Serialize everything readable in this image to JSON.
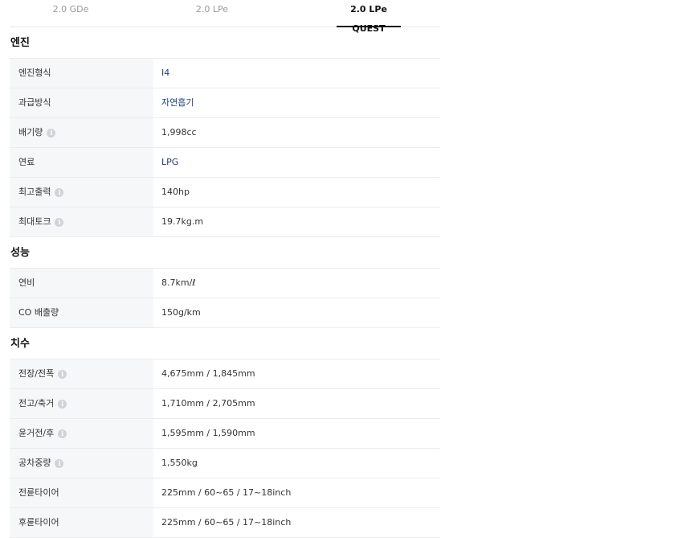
{
  "tabs": [
    {
      "label": "2.0 GDe"
    },
    {
      "label": "2.0 LPe"
    },
    {
      "label": "2.0 LPe QUEST"
    }
  ],
  "sections": {
    "engine": {
      "title": "엔진",
      "rows": [
        {
          "label": "엔진형식",
          "value": "I4"
        },
        {
          "label": "과급방식",
          "value": "자연흡기"
        },
        {
          "label": "배기량",
          "value": "1,998cc"
        },
        {
          "label": "연료",
          "value": "LPG"
        },
        {
          "label": "최고출력",
          "value": "140hp"
        },
        {
          "label": "최대토크",
          "value": "19.7kg.m"
        }
      ]
    },
    "performance": {
      "title": "성능",
      "rows": [
        {
          "label": "연비",
          "value": "8.7km/ℓ"
        },
        {
          "label": "CO 배출량",
          "value": "150g/km"
        }
      ]
    },
    "dimensions": {
      "title": "치수",
      "rows": [
        {
          "label": "전장/전폭",
          "value": "4,675mm / 1,845mm"
        },
        {
          "label": "전고/축거",
          "value": "1,710mm / 2,705mm"
        },
        {
          "label": "윤거전/후",
          "value": "1,595mm / 1,590mm"
        },
        {
          "label": "공차중량",
          "value": "1,550kg"
        },
        {
          "label": "전륜타이어",
          "value": "225mm / 60~65 / 17~18inch"
        },
        {
          "label": "후륜타이어",
          "value": "225mm / 60~65 / 17~18inch"
        }
      ]
    }
  }
}
